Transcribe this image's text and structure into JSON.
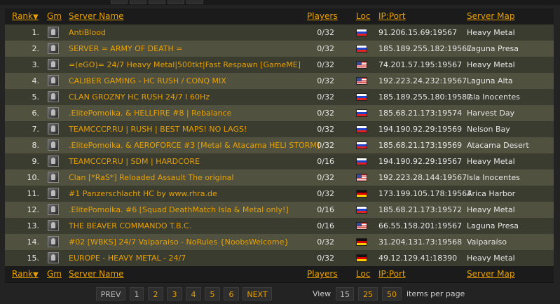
{
  "columns": {
    "rank": "Rank",
    "rank_arrow": "▼",
    "gm": "Gm",
    "name": "Server Name",
    "players": "Players",
    "loc": "Loc",
    "ip": "IP:Port",
    "map": "Server Map"
  },
  "rows": [
    {
      "rank": "1.",
      "name": "AntiBlood",
      "players": "0/32",
      "flag": "ru",
      "ip": "91.206.15.69:19567",
      "map": "Heavy Metal"
    },
    {
      "rank": "2.",
      "name": "SERVER = ARMY OF DEATH =",
      "players": "0/32",
      "flag": "ru",
      "ip": "185.189.255.182:19567",
      "map": "Laguna Presa"
    },
    {
      "rank": "3.",
      "name": "=(eGO)= 24/7 Heavy Metal|500tkt|Fast Respawn [GameME]",
      "players": "0/32",
      "flag": "us",
      "ip": "74.201.57.195:19567",
      "map": "Heavy Metal"
    },
    {
      "rank": "4.",
      "name": "CALIBER GAMING - HC RUSH / CONQ MIX",
      "players": "0/32",
      "flag": "us",
      "ip": "192.223.24.232:19567",
      "map": "Laguna Alta"
    },
    {
      "rank": "5.",
      "name": "CLAN GROZNY HC RUSH 24/7 I 60Hz",
      "players": "0/32",
      "flag": "ru",
      "ip": "185.189.255.180:19587",
      "map": "Isla Inocentes"
    },
    {
      "rank": "6.",
      "name": ".ElitePomoika. & HELLFIRE #8 | Rebalance",
      "players": "0/32",
      "flag": "ru",
      "ip": "185.68.21.173:19574",
      "map": "Harvest Day"
    },
    {
      "rank": "7.",
      "name": "TEAMCCCP.RU | RUSH | BEST MAPS! NO LAGS!",
      "players": "0/32",
      "flag": "ru",
      "ip": "194.190.92.29:19569",
      "map": "Nelson Bay"
    },
    {
      "rank": "8.",
      "name": ".ElitePomoika. & AEROFORCE #3 [Metal & Atacama HELI STORM]",
      "players": "0/32",
      "flag": "ru",
      "ip": "185.68.21.173:19569",
      "map": "Atacama Desert"
    },
    {
      "rank": "9.",
      "name": "TEAMCCCP.RU | SDM | HARDCORE",
      "players": "0/16",
      "flag": "ru",
      "ip": "194.190.92.29:19567",
      "map": "Heavy Metal"
    },
    {
      "rank": "10.",
      "name": "Clan [*RaS*] Reloaded Assault The original",
      "players": "0/32",
      "flag": "us",
      "ip": "192.223.28.144:19567",
      "map": "Isla Inocentes"
    },
    {
      "rank": "11.",
      "name": "#1 Panzerschlacht HC by www.rhra.de",
      "players": "0/32",
      "flag": "de",
      "ip": "173.199.105.178:19567",
      "map": "Arica Harbor"
    },
    {
      "rank": "12.",
      "name": ".ElitePomoika. #6 [Squad DeathMatch Isla & Metal only!]",
      "players": "0/16",
      "flag": "ru",
      "ip": "185.68.21.173:19572",
      "map": "Heavy Metal"
    },
    {
      "rank": "13.",
      "name": "THE BEAVER COMMANDO T.B.C.",
      "players": "0/16",
      "flag": "us",
      "ip": "66.55.158.201:19567",
      "map": "Laguna Presa"
    },
    {
      "rank": "14.",
      "name": "#02 [WBKS] 24/7 Valparaiso - NoRules {NoobsWelcome}",
      "players": "0/32",
      "flag": "de",
      "ip": "31.204.131.73:19568",
      "map": "Valparaíso"
    },
    {
      "rank": "15.",
      "name": "EUROPE - HEAVY METAL - 24/7",
      "players": "0/32",
      "flag": "de",
      "ip": "49.12.129.41:18390",
      "map": "Heavy Metal"
    }
  ],
  "pagination": {
    "prev": "PREV",
    "pages": [
      "1",
      "2",
      "3",
      "4",
      "5",
      "6"
    ],
    "next": "NEXT",
    "view_label": "View",
    "per_page": [
      "15",
      "25",
      "50"
    ],
    "per_page_suffix": "items per page"
  },
  "colors": {
    "accent": "#e8a000",
    "row_odd": "#3a3c30",
    "row_even": "#50523f"
  }
}
